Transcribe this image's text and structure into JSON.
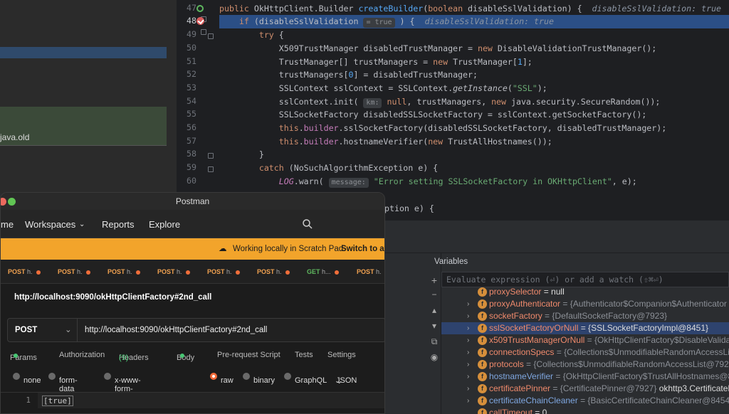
{
  "project": {
    "file_label": "java.old"
  },
  "editor": {
    "lines": [
      {
        "n": "47"
      },
      {
        "n": "48"
      },
      {
        "n": "49"
      },
      {
        "n": "50"
      },
      {
        "n": "51"
      },
      {
        "n": "52"
      },
      {
        "n": "53"
      },
      {
        "n": "54"
      },
      {
        "n": "55"
      },
      {
        "n": "56"
      },
      {
        "n": "57"
      },
      {
        "n": "58"
      },
      {
        "n": "59"
      },
      {
        "n": "60"
      }
    ],
    "hint_47": "disableSslValidation: true",
    "hint_48_inline": "= true",
    "hint_48": "disableSslValidation: true",
    "hint_km": "km:",
    "hint_message": "message:",
    "str_ssl": "\"SSL\"",
    "str_err": "\"Error setting SSLSocketFactory in OKHttpClient\""
  },
  "postman": {
    "title": "Postman",
    "nav": {
      "home": "me",
      "workspaces": "Workspaces",
      "reports": "Reports",
      "explore": "Explore"
    },
    "banner": {
      "text": "Working locally in Scratch Pad.",
      "link": "Switch to a W"
    },
    "tabs": [
      {
        "method": "POST",
        "name": "h."
      },
      {
        "method": "POST",
        "name": "h."
      },
      {
        "method": "POST",
        "name": "h."
      },
      {
        "method": "POST",
        "name": "h."
      },
      {
        "method": "POST",
        "name": "h."
      },
      {
        "method": "POST",
        "name": "h."
      },
      {
        "method": "GET",
        "name": "h..."
      },
      {
        "method": "POST",
        "name": "h."
      }
    ],
    "request_name": "http://localhost:9090/okHttpClientFactory#2nd_call",
    "method": "POST",
    "url": "http://localhost:9090/okHttpClientFactory#2nd_call",
    "req_tabs": {
      "params": "Params",
      "authorization": "Authorization",
      "headers": "Headers",
      "headers_count": "(9)",
      "body": "Body",
      "prerequest": "Pre-request Script",
      "tests": "Tests",
      "settings": "Settings"
    },
    "body_options": {
      "none": "none",
      "form_data": "form-data",
      "urlencoded": "x-www-form-urlencoded",
      "raw": "raw",
      "binary": "binary",
      "graphql": "GraphQL",
      "json": "JSON"
    },
    "body_line_number": "1",
    "body_text": "[true]"
  },
  "debugger": {
    "variables_title": "Variables",
    "eval_placeholder": "Evaluate expression (⏎) or add a watch (⇧⌘⏎)",
    "vars": [
      {
        "name": "proxySelector",
        "value": "= null",
        "expand": false
      },
      {
        "name": "proxyAuthenticator",
        "value": "= {Authenticator$Companion$Authenticator",
        "expand": true
      },
      {
        "name": "socketFactory",
        "value": "= {DefaultSocketFactory@7923}",
        "expand": true
      },
      {
        "name": "sslSocketFactoryOrNull",
        "value": "= {SSLSocketFactoryImpl@8451}",
        "expand": true,
        "selected": true
      },
      {
        "name": "x509TrustManagerOrNull",
        "value": "= {OkHttpClientFactory$DisableValidati",
        "expand": true
      },
      {
        "name": "connectionSpecs",
        "value": "= {Collections$UnmodifiableRandomAccessLis",
        "expand": true
      },
      {
        "name": "protocols",
        "value": "= {Collections$UnmodifiableRandomAccessList@7925",
        "expand": true
      },
      {
        "name": "hostnameVerifier",
        "value": "= {OkHttpClientFactory$TrustAllHostnames@8",
        "expand": true
      },
      {
        "name": "certificatePinner",
        "value": "= {CertificatePinner@7927}",
        "extra": "okhttp3.CertificateP",
        "expand": true
      },
      {
        "name": "certificateChainCleaner",
        "value": "= {BasicCertificateChainCleaner@8454}",
        "extra": "c",
        "expand": true
      },
      {
        "name": "callTimeout",
        "value": "= 0",
        "expand": false
      }
    ]
  }
}
